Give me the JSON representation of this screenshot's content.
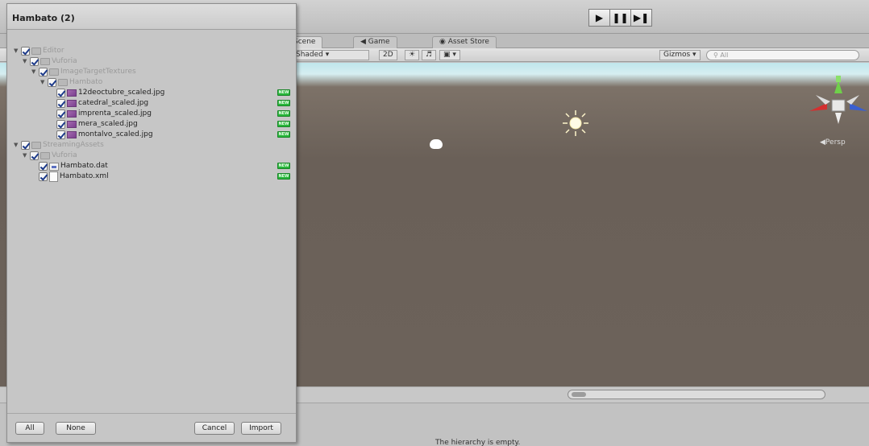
{
  "dialog": {
    "title": "Hambato (2)",
    "buttons": {
      "all": "All",
      "none": "None",
      "cancel": "Cancel",
      "import": "Import"
    },
    "tree": [
      {
        "label": "Editor",
        "depth": 0,
        "icon": "folder",
        "expanded": true,
        "dimmed": true,
        "new": false
      },
      {
        "label": "Vuforia",
        "depth": 1,
        "icon": "folder",
        "expanded": true,
        "dimmed": true,
        "new": false
      },
      {
        "label": "ImageTargetTextures",
        "depth": 2,
        "icon": "folder",
        "expanded": true,
        "dimmed": true,
        "new": false
      },
      {
        "label": "Hambato",
        "depth": 3,
        "icon": "folder",
        "expanded": true,
        "dimmed": true,
        "new": false
      },
      {
        "label": "12deoctubre_scaled.jpg",
        "depth": 4,
        "icon": "image",
        "expanded": null,
        "dimmed": false,
        "new": true
      },
      {
        "label": "catedral_scaled.jpg",
        "depth": 4,
        "icon": "image",
        "expanded": null,
        "dimmed": false,
        "new": true
      },
      {
        "label": "imprenta_scaled.jpg",
        "depth": 4,
        "icon": "image",
        "expanded": null,
        "dimmed": false,
        "new": true
      },
      {
        "label": "mera_scaled.jpg",
        "depth": 4,
        "icon": "image",
        "expanded": null,
        "dimmed": false,
        "new": true
      },
      {
        "label": "montalvo_scaled.jpg",
        "depth": 4,
        "icon": "image",
        "expanded": null,
        "dimmed": false,
        "new": true
      },
      {
        "label": "StreamingAssets",
        "depth": 0,
        "icon": "folder",
        "expanded": true,
        "dimmed": true,
        "new": false
      },
      {
        "label": "Vuforia",
        "depth": 1,
        "icon": "folder",
        "expanded": true,
        "dimmed": true,
        "new": false
      },
      {
        "label": "Hambato.dat",
        "depth": 2,
        "icon": "data",
        "expanded": null,
        "dimmed": false,
        "new": true
      },
      {
        "label": "Hambato.xml",
        "depth": 2,
        "icon": "file",
        "expanded": null,
        "dimmed": false,
        "new": true
      }
    ],
    "new_badge": "NEW"
  },
  "toolbar": {
    "play_icon": "play-icon",
    "pause_icon": "pause-icon",
    "step_icon": "step-icon"
  },
  "tabs": {
    "scene": "Scene",
    "game": "Game",
    "asset_store": "Asset Store"
  },
  "scene_controls": {
    "shading": "Shaded",
    "mode_2d": "2D",
    "gizmos": "Gizmos",
    "search_placeholder": "All"
  },
  "viewport": {
    "persp_label": "Persp"
  },
  "status": {
    "text": "The hierarchy is empty."
  },
  "colors": {
    "new_badge": "#27b63a",
    "sky": "#bfe6ec",
    "ground": "#6a6058",
    "gizmo_y": "#6fd04a",
    "gizmo_x": "#d33030",
    "gizmo_z": "#3a5fd0"
  }
}
